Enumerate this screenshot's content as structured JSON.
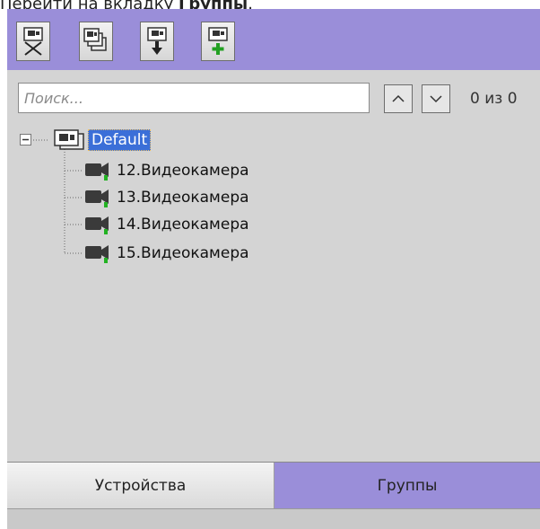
{
  "instruction": {
    "text_prefix": "Перейти на вкладку ",
    "text_bold": "Группы",
    "text_suffix": "."
  },
  "toolbar": {
    "buttons": [
      {
        "icon": "remove-camera-icon"
      },
      {
        "icon": "copy-group-icon"
      },
      {
        "icon": "move-camera-icon"
      },
      {
        "icon": "add-camera-icon"
      }
    ]
  },
  "search": {
    "placeholder": "Поиск...",
    "value": "",
    "counter": "0 из 0"
  },
  "tree": {
    "root": {
      "label": "Default",
      "expanded": true,
      "selected": true
    },
    "items": [
      {
        "label": "12.Видеокамера"
      },
      {
        "label": "13.Видеокамера"
      },
      {
        "label": "14.Видеокамера"
      },
      {
        "label": "15.Видеокамера"
      }
    ]
  },
  "tabs": [
    {
      "label": "Устройства",
      "active": false
    },
    {
      "label": "Группы",
      "active": true
    }
  ],
  "colors": {
    "accent": "#9a8ed9",
    "panel": "#d4d4d4",
    "selection": "#3b6fd8",
    "camera_indicator": "#22b222"
  }
}
